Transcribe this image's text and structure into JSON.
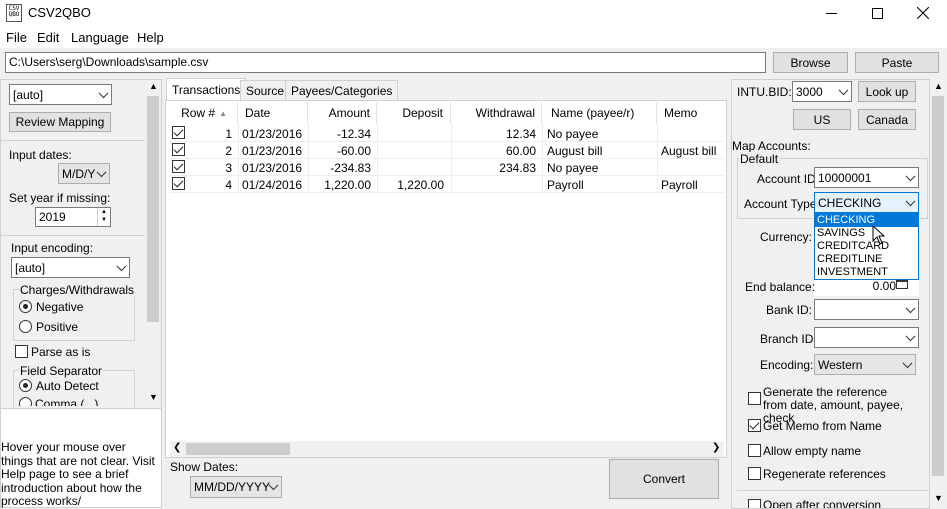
{
  "window": {
    "title": "CSV2QBO",
    "icon_text": "CSV QBO"
  },
  "menu": [
    "File",
    "Edit",
    "Language",
    "Help"
  ],
  "file_path": "C:\\Users\\serg\\Downloads\\sample.csv",
  "browse_label": "Browse",
  "paste_label": "Paste",
  "left": {
    "mapping_select": "[auto]",
    "review_mapping": "Review Mapping",
    "input_dates_label": "Input dates:",
    "date_format": "M/D/Y",
    "set_year_label": "Set year if missing:",
    "year": "2019",
    "encoding_label": "Input encoding:",
    "encoding": "[auto]",
    "charges_group": "Charges/Withdrawals",
    "negative": "Negative",
    "positive": "Positive",
    "parse_as_is": "Parse as is",
    "field_separator": "Field Separator",
    "auto_detect": "Auto Detect",
    "comma": "Comma ( , )",
    "help_text": "Hover your mouse over things that are not clear. Visit Help page to see a brief introduction about how the process works/"
  },
  "tabs": [
    "Transactions",
    "Source",
    "Payees/Categories"
  ],
  "table": {
    "columns": [
      "Row #",
      "Date",
      "Amount",
      "Deposit",
      "Withdrawal",
      "Name (payee/r)",
      "Memo"
    ],
    "rows": [
      {
        "row": "1",
        "date": "01/23/2016",
        "amount": "-12.34",
        "deposit": "",
        "withdrawal": "12.34",
        "name": "No payee",
        "memo": ""
      },
      {
        "row": "2",
        "date": "01/23/2016",
        "amount": "-60.00",
        "deposit": "",
        "withdrawal": "60.00",
        "name": "August bill",
        "memo": "August bill"
      },
      {
        "row": "3",
        "date": "01/23/2016",
        "amount": "-234.83",
        "deposit": "",
        "withdrawal": "234.83",
        "name": "No payee",
        "memo": ""
      },
      {
        "row": "4",
        "date": "01/24/2016",
        "amount": "1,220.00",
        "deposit": "1,220.00",
        "withdrawal": "",
        "name": "Payroll",
        "memo": "Payroll"
      }
    ]
  },
  "show_dates_label": "Show Dates:",
  "show_dates_format": "MM/DD/YYYY",
  "convert_label": "Convert",
  "right": {
    "intu_bid_label": "INTU.BID:",
    "intu_bid": "3000",
    "lookup": "Look up",
    "us": "US",
    "canada": "Canada",
    "map_accounts": "Map Accounts:",
    "default": "Default",
    "account_id_label": "Account ID:",
    "account_id": "10000001",
    "account_type_label": "Account Type:",
    "account_type": "CHECKING",
    "account_type_options": [
      "CHECKING",
      "SAVINGS",
      "CREDITCARD",
      "CREDITLINE",
      "INVESTMENT"
    ],
    "currency_label": "Currency:",
    "end_balance_label": "End balance:",
    "end_balance": "0.00",
    "bank_id_label": "Bank ID:",
    "branch_id_label": "Branch ID",
    "encoding_label": "Encoding:",
    "encoding": "Western",
    "generate_ref": "Generate the reference from date, amount, payee, check",
    "get_memo": "Get Memo from Name",
    "allow_empty": "Allow empty name",
    "regen_refs": "Regenerate references",
    "open_after": "Open after conversion"
  },
  "colors": {
    "selection": "#0078d7",
    "accent_border": "#0078d7"
  }
}
